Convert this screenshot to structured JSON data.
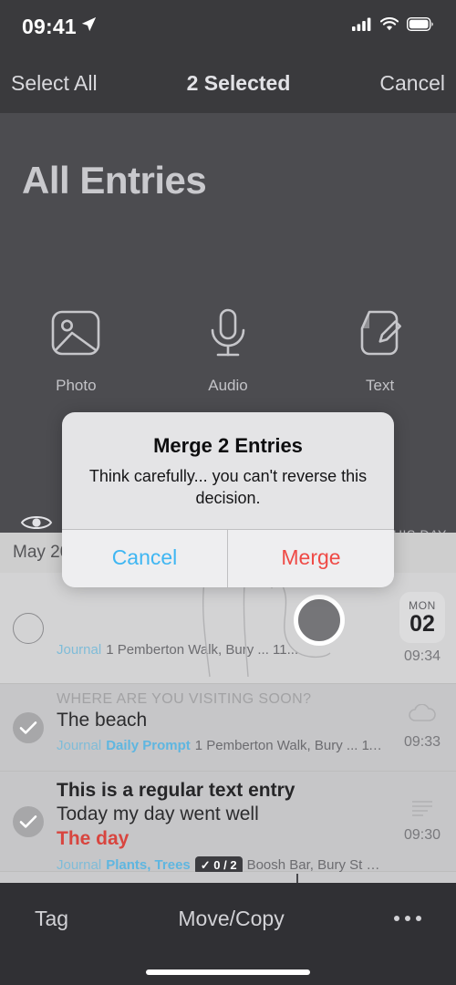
{
  "status_bar": {
    "time": "09:41",
    "location_icon": "location-arrow-icon",
    "cellular_icon": "cellular-signal-icon",
    "wifi_icon": "wifi-icon",
    "battery_icon": "battery-full-icon"
  },
  "selection_toolbar": {
    "select_all_label": "Select All",
    "title": "2 Selected",
    "cancel_label": "Cancel"
  },
  "header": {
    "page_title": "All Entries",
    "quick_actions": [
      {
        "label": "Photo",
        "icon": "photo-icon"
      },
      {
        "label": "Audio",
        "icon": "microphone-icon"
      },
      {
        "label": "Text",
        "icon": "text-entry-icon"
      }
    ],
    "eye_icon": "eye-icon",
    "on_this_day_label": "N THIS DAY"
  },
  "list": {
    "date_header": "May 202",
    "rows": [
      {
        "selected": false,
        "prompt": "",
        "title": "",
        "subtitle": "",
        "highlight": "",
        "meta_journal": "Journal",
        "meta_tags": "",
        "meta_badge": "",
        "meta_text": "1 Pemberton Walk, Bury ... 11...",
        "time": "09:34",
        "day_of_week": "MON",
        "day_number": "02",
        "right_icon": "drawing-thumbnail"
      },
      {
        "selected": true,
        "prompt": "WHERE ARE YOU VISITING SOON?",
        "title": "The beach",
        "subtitle": "",
        "highlight": "",
        "meta_journal": "Journal",
        "meta_tags": "Daily Prompt",
        "meta_badge": "",
        "meta_text": "1 Pemberton Walk, Bury ... 11°C Cl...",
        "time": "09:33",
        "day_of_week": "",
        "day_number": "",
        "right_icon": "cloud-icon"
      },
      {
        "selected": true,
        "prompt": "",
        "title": "This is a regular text entry",
        "subtitle": "Today my day went well",
        "highlight": "The day",
        "meta_journal": "Journal",
        "meta_tags": "Plants, Trees",
        "meta_badge": "✓ 0 / 2",
        "meta_text": "Boosh Bar, Bury St Edm...",
        "time": "09:30",
        "day_of_week": "",
        "day_number": "",
        "right_icon": "text-lines-icon"
      }
    ]
  },
  "alert": {
    "title": "Merge 2 Entries",
    "message": "Think carefully... you can't reverse this decision.",
    "cancel_label": "Cancel",
    "confirm_label": "Merge"
  },
  "bottom_bar": {
    "tag_label": "Tag",
    "move_copy_label": "Move/Copy",
    "more_icon": "more-dots-icon"
  },
  "colors": {
    "accent_blue": "#3fb6f2",
    "destructive_red": "#ef4a46",
    "tag_blue": "#5fb6e0",
    "highlight_red": "#d8453f",
    "chrome_dark": "#3a3a3d",
    "background_dark": "#4c4c50",
    "list_background": "#cecece"
  }
}
